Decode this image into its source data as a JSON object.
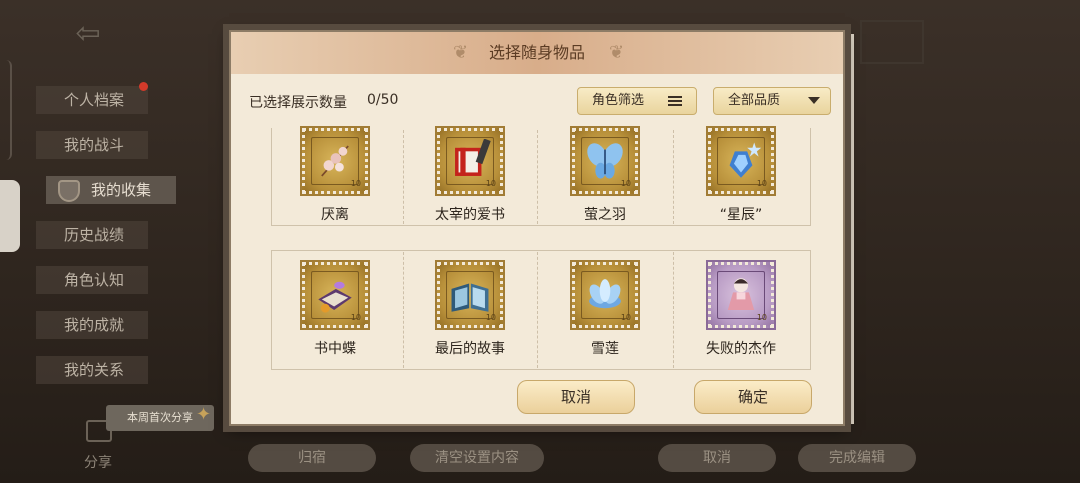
{
  "sidebar": {
    "items": [
      {
        "label": "个人档案"
      },
      {
        "label": "我的战斗"
      },
      {
        "label": "我的收集"
      },
      {
        "label": "历史战绩"
      },
      {
        "label": "角色认知"
      },
      {
        "label": "我的成就"
      },
      {
        "label": "我的关系"
      }
    ],
    "share_tip": "本周首次分享",
    "share_label": "分享"
  },
  "bottom_bar": {
    "btn1": "归宿",
    "btn2": "清空设置内容",
    "btn3": "取消",
    "btn4": "完成编辑"
  },
  "modal": {
    "title": "选择随身物品",
    "count_label": "已选择展示数量",
    "count_value": "0/50",
    "filter_role": "角色筛选",
    "filter_quality": "全部品质",
    "items": [
      {
        "name": "厌离",
        "icon": "cherry-blossom-branch"
      },
      {
        "name": "太宰的爱书",
        "icon": "red-book"
      },
      {
        "name": "萤之羽",
        "icon": "blue-butterfly"
      },
      {
        "name": "“星辰”",
        "icon": "star-crystal"
      },
      {
        "name": "书中蝶",
        "icon": "purple-book-butterfly"
      },
      {
        "name": "最后的故事",
        "icon": "open-blue-book"
      },
      {
        "name": "雪莲",
        "icon": "snow-lotus"
      },
      {
        "name": "失败的杰作",
        "icon": "doll"
      }
    ],
    "cancel": "取消",
    "confirm": "确定"
  }
}
